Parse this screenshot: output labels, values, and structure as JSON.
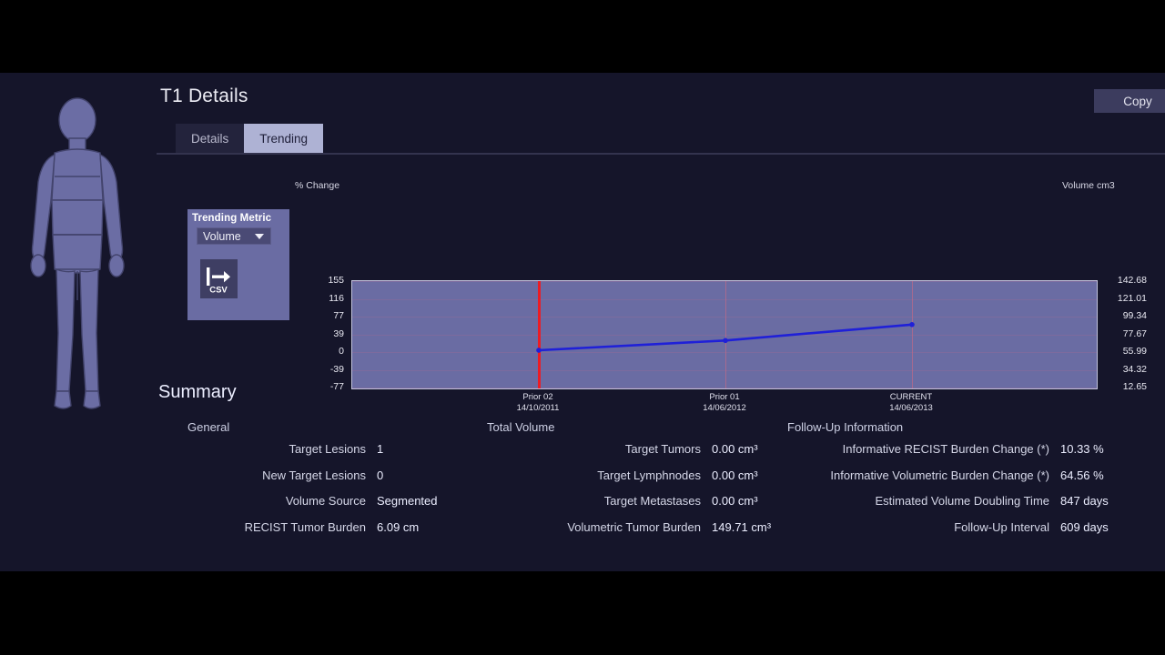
{
  "header": {
    "title": "T1 Details",
    "copy_label": "Copy"
  },
  "tabs": [
    {
      "label": "Details",
      "active": false
    },
    {
      "label": "Trending",
      "active": true
    }
  ],
  "metric_panel": {
    "title": "Trending Metric",
    "selected_metric": "Volume",
    "options": [
      "Volume"
    ],
    "export_label": "CSV",
    "export_icon": "export-arrow-icon"
  },
  "chart_data": {
    "type": "line",
    "title": "",
    "xlabel": "",
    "ylabel": "% Change",
    "y2label": "Volume  cm3",
    "categories": [
      "Prior 02",
      "Prior 01",
      "CURRENT"
    ],
    "x_dates": [
      "14/10/2011",
      "14/06/2012",
      "14/06/2013"
    ],
    "series": [
      {
        "name": "Volume",
        "values": [
          0,
          24.5,
          64.56
        ],
        "color": "#1f20d8"
      }
    ],
    "yticks_left": [
      155,
      116,
      77,
      39,
      0,
      -39,
      -77
    ],
    "yticks_right": [
      "142.68",
      "121.01",
      "99.34",
      "77.67",
      "55.99",
      "34.32",
      "12.65"
    ],
    "ylim": [
      -96.25,
      174.25
    ],
    "grid": true,
    "legend": "none",
    "marker_line": {
      "at": "Prior 02",
      "color": "#ec1c24"
    },
    "plot_bg": "#6a6ca3"
  },
  "summary": {
    "title": "Summary",
    "columns": [
      {
        "head": "General",
        "rows": [
          {
            "label": "Target Lesions",
            "value": "1"
          },
          {
            "label": "New Target Lesions",
            "value": "0"
          },
          {
            "label": "Volume Source",
            "value": "Segmented"
          },
          {
            "label": "RECIST Tumor Burden",
            "value": "6.09 cm"
          }
        ]
      },
      {
        "head": "Total Volume",
        "rows": [
          {
            "label": "Target Tumors",
            "value": "0.00 cm³"
          },
          {
            "label": "Target Lymphnodes",
            "value": "0.00 cm³"
          },
          {
            "label": "Target Metastases",
            "value": "0.00 cm³"
          },
          {
            "label": "Volumetric Tumor Burden",
            "value": "149.71 cm³"
          }
        ]
      },
      {
        "head": "Follow-Up Information",
        "rows": [
          {
            "label": "Informative RECIST Burden Change (*)",
            "value": "10.33 %"
          },
          {
            "label": "Informative Volumetric Burden Change (*)",
            "value": "64.56 %"
          },
          {
            "label": "Estimated Volume Doubling Time",
            "value": "847 days"
          },
          {
            "label": "Follow-Up Interval",
            "value": "609 days"
          }
        ]
      }
    ]
  },
  "body_figure": {
    "name": "patient-body-silhouette",
    "fill": "#6b6da4",
    "stroke": "#43446d"
  },
  "colors": {
    "app_bg": "#15152a",
    "letterbox": "#000000",
    "accent": "#aeb2d4",
    "panel": "#6a6ca3",
    "series": "#1f20d8",
    "marker": "#ec1c24"
  }
}
